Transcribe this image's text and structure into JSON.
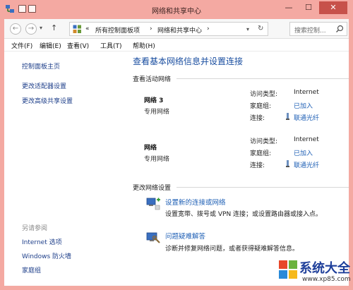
{
  "window": {
    "title": "网络和共享中心",
    "minimize": "—",
    "maximize": "☐",
    "close": "✕"
  },
  "addressbar": {
    "back": "←",
    "forward": "→",
    "dropdown": "▾",
    "up": "↑",
    "chevron": "«",
    "crumbs": [
      "所有控制面板项",
      "网络和共享中心"
    ],
    "sep": "›",
    "refresh": "↻",
    "search_placeholder": "搜索控制..."
  },
  "menubar": {
    "items": [
      "文件(F)",
      "编辑(E)",
      "查看(V)",
      "工具(T)",
      "帮助(H)"
    ]
  },
  "sidebar": {
    "links": [
      "控制面板主页",
      "更改适配器设置",
      "更改高级共享设置"
    ],
    "see_also_heading": "另请参阅",
    "see_also": [
      "Internet 选项",
      "Windows 防火墙",
      "家庭组"
    ]
  },
  "main": {
    "title": "查看基本网络信息并设置连接",
    "active_networks_heading": "查看活动网络",
    "networks": [
      {
        "name": "网络  3",
        "type": "专用网络",
        "access_key": "访问类型:",
        "access_val": "Internet",
        "homegroup_key": "家庭组:",
        "homegroup_val": "已加入",
        "conn_key": "连接:",
        "conn_val": "联通光纤"
      },
      {
        "name": "网络",
        "type": "专用网络",
        "access_key": "访问类型:",
        "access_val": "Internet",
        "homegroup_key": "家庭组:",
        "homegroup_val": "已加入",
        "conn_key": "连接:",
        "conn_val": "联通光纤"
      }
    ],
    "change_heading": "更改网络设置",
    "tasks": [
      {
        "link": "设置新的连接或网络",
        "desc": "设置宽带、拨号或 VPN 连接；或设置路由器或接入点。"
      },
      {
        "link": "问题疑难解答",
        "desc": "诊断并修复网络问题，或者获得疑难解答信息。"
      }
    ]
  },
  "watermark": {
    "text": "系统大全",
    "url": "www.xp85.com"
  },
  "colors": {
    "frame": "#f4a9a2",
    "link": "#1e5fb5",
    "title_blue": "#1a4ea0",
    "close_red": "#c7514a"
  }
}
